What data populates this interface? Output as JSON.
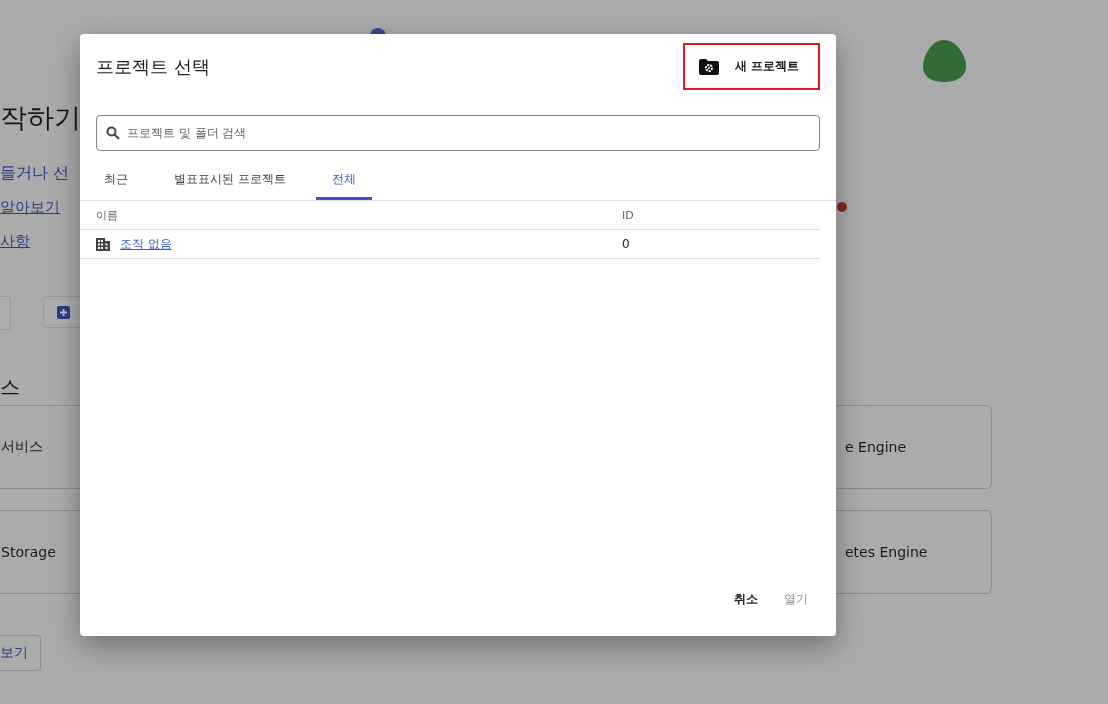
{
  "background": {
    "heading": "작하기",
    "lines": [
      {
        "text": "들거나 선",
        "kind": "text"
      },
      {
        "text": "알아보기",
        "kind": "link"
      },
      {
        "text": "사항",
        "kind": "link"
      }
    ],
    "section_heading": "스",
    "cards": [
      {
        "label": "서비스"
      },
      {
        "label": "e Engine"
      },
      {
        "label": "Storage"
      },
      {
        "label": "etes Engine"
      }
    ],
    "more_button": "보기"
  },
  "dialog": {
    "title": "프로젝트 선택",
    "new_project_button": {
      "label": "새 프로젝트",
      "highlighted": true
    },
    "search": {
      "placeholder": "프로젝트 및 폴더 검색"
    },
    "tabs": [
      {
        "label": "최근",
        "selected": false
      },
      {
        "label": "별표표시된 프로젝트",
        "selected": false
      },
      {
        "label": "전체",
        "selected": true
      }
    ],
    "table": {
      "columns": [
        "이름",
        "ID"
      ],
      "rows": [
        {
          "name": "조직 없음",
          "id": "0"
        }
      ]
    },
    "buttons": [
      {
        "label": "취소",
        "disabled": false
      },
      {
        "label": "열기",
        "disabled": true
      }
    ]
  }
}
